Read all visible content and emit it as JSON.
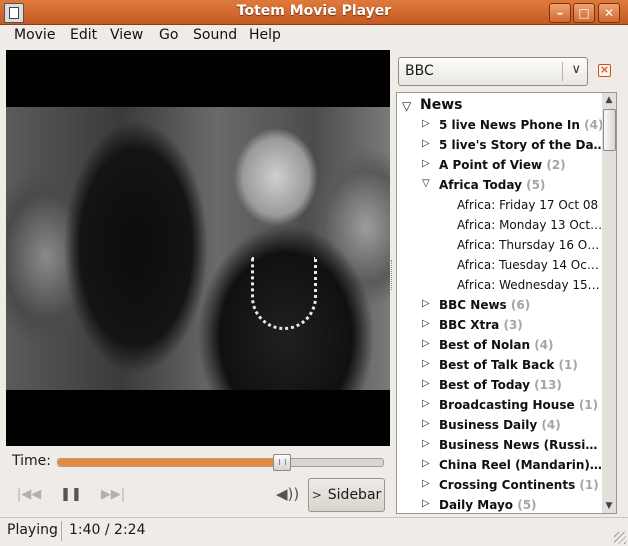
{
  "window": {
    "title": "Totem Movie Player"
  },
  "menu": {
    "movie": "Movie",
    "edit": "Edit",
    "view": "View",
    "go": "Go",
    "sound": "Sound",
    "help": "Help"
  },
  "time": {
    "label": "Time:",
    "progress": 0.685
  },
  "controls": {
    "sidebar_label": "Sidebar"
  },
  "sidebar": {
    "source": "BBC",
    "tree": [
      {
        "label": "News",
        "count": "",
        "expander": "open"
      },
      {
        "label": "5 live News Phone In",
        "count": "(4)",
        "expander": "closed"
      },
      {
        "label": "5 live's Story of the Da…",
        "count": "",
        "expander": "closed"
      },
      {
        "label": "A Point of View",
        "count": "(2)",
        "expander": "closed"
      },
      {
        "label": "Africa Today",
        "count": "(5)",
        "expander": "open"
      },
      {
        "label": "Africa: Friday 17 Oct 08",
        "count": "",
        "expander": ""
      },
      {
        "label": "Africa: Monday 13 Oct…",
        "count": "",
        "expander": ""
      },
      {
        "label": "Africa: Thursday 16 O…",
        "count": "",
        "expander": ""
      },
      {
        "label": "Africa: Tuesday 14 Oc…",
        "count": "",
        "expander": ""
      },
      {
        "label": "Africa: Wednesday 15…",
        "count": "",
        "expander": ""
      },
      {
        "label": "BBC News",
        "count": "(6)",
        "expander": "closed"
      },
      {
        "label": "BBC Xtra",
        "count": "(3)",
        "expander": "closed"
      },
      {
        "label": "Best of Nolan",
        "count": "(4)",
        "expander": "closed"
      },
      {
        "label": "Best of Talk Back",
        "count": "(1)",
        "expander": "closed"
      },
      {
        "label": "Best of Today",
        "count": "(13)",
        "expander": "closed"
      },
      {
        "label": "Broadcasting House",
        "count": "(1)",
        "expander": "closed"
      },
      {
        "label": "Business Daily",
        "count": "(4)",
        "expander": "closed"
      },
      {
        "label": "Business News (Russi…",
        "count": "",
        "expander": "closed"
      },
      {
        "label": "China Reel (Mandarin)…",
        "count": "",
        "expander": "closed"
      },
      {
        "label": "Crossing Continents",
        "count": "(1)",
        "expander": "closed"
      },
      {
        "label": "Daily Mayo",
        "count": "(5)",
        "expander": "closed"
      }
    ]
  },
  "status": {
    "state": "Playing",
    "time": "1:40 / 2:24"
  }
}
